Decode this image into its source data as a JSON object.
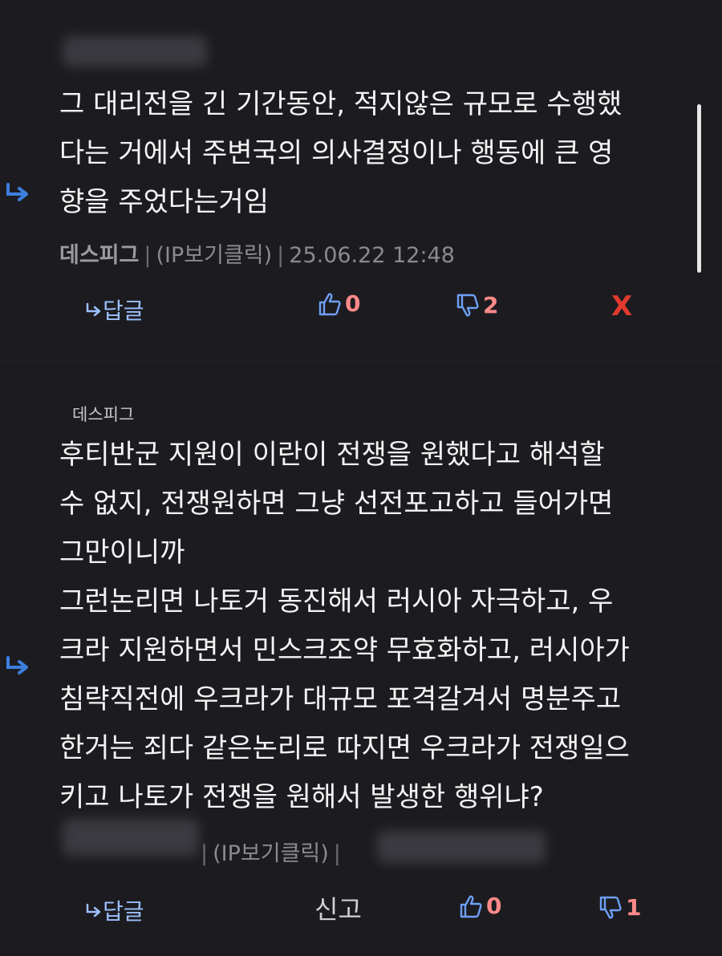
{
  "comment1": {
    "body": "그 대리전을 긴 기간동안, 적지않은 규모로 수행했\n다는 거에서 주변국의 의사결정이나 행동에 큰 영\n향을 주었다는거임",
    "author": "데스피그",
    "ip_label": "(IP보기클릭)",
    "timestamp": "25.06.22 12:48",
    "reply_label": "답글",
    "likes": "0",
    "dislikes": "2",
    "delete_label": "X"
  },
  "comment2": {
    "reply_to": "데스피그",
    "body": "후티반군 지원이 이란이 전쟁을 원했다고 해석할\n수 없지, 전쟁원하면 그냥 선전포고하고 들어가면\n그만이니까\n그런논리면 나토거 동진해서 러시아 자극하고, 우\n크라 지원하면서 민스크조약 무효화하고, 러시아가\n침략직전에 우크라가 대규모 포격갈겨서 명분주고\n한거는 죄다 같은논리로 따지면 우크라가 전쟁일으\n키고 나토가 전쟁을 원해서 발생한 행위냐?",
    "ip_label": "(IP보기클릭)",
    "reply_label": "답글",
    "report_label": "신고",
    "likes": "0",
    "dislikes": "1"
  },
  "colors": {
    "background": "#1c1c20",
    "text": "#f4f4f4",
    "meta": "#8a8a8f",
    "reply_accent": "#3d7fe0",
    "count": "#ff8a8a",
    "delete": "#e03a2e"
  },
  "icons": [
    "reply-arrow-icon",
    "thumbs-up-icon",
    "thumbs-down-icon"
  ]
}
